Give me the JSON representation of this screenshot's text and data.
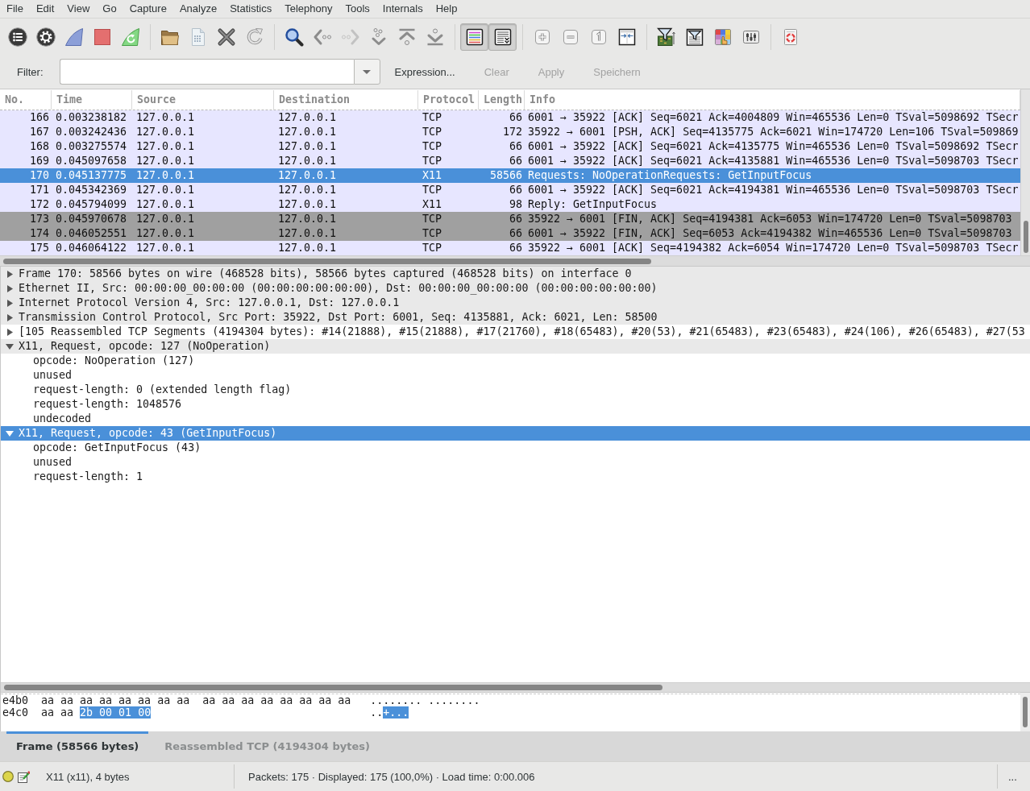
{
  "menu": [
    "File",
    "Edit",
    "View",
    "Go",
    "Capture",
    "Analyze",
    "Statistics",
    "Telephony",
    "Tools",
    "Internals",
    "Help"
  ],
  "toolbar": [
    [
      {
        "kind": "interfaces",
        "pressed": false,
        "disabled": false
      },
      {
        "kind": "options",
        "pressed": false,
        "disabled": false
      },
      {
        "kind": "start",
        "pressed": false,
        "disabled": false
      },
      {
        "kind": "stop",
        "pressed": false,
        "disabled": false
      },
      {
        "kind": "restart",
        "pressed": false,
        "disabled": false
      }
    ],
    [
      {
        "kind": "open",
        "pressed": false,
        "disabled": false
      },
      {
        "kind": "save",
        "pressed": false,
        "disabled": false
      },
      {
        "kind": "close",
        "pressed": false,
        "disabled": false
      },
      {
        "kind": "reload",
        "pressed": false,
        "disabled": false
      }
    ],
    [
      {
        "kind": "find",
        "pressed": false,
        "disabled": false
      },
      {
        "kind": "back",
        "pressed": false,
        "disabled": false
      },
      {
        "kind": "forward",
        "pressed": false,
        "disabled": true
      },
      {
        "kind": "goto",
        "pressed": false,
        "disabled": false
      },
      {
        "kind": "first",
        "pressed": false,
        "disabled": false
      },
      {
        "kind": "last",
        "pressed": false,
        "disabled": false
      }
    ],
    [
      {
        "kind": "colorize",
        "pressed": true,
        "disabled": false
      },
      {
        "kind": "autoscroll",
        "pressed": true,
        "disabled": false
      }
    ],
    [
      {
        "kind": "zoomin",
        "pressed": false,
        "disabled": false
      },
      {
        "kind": "zoomout",
        "pressed": false,
        "disabled": false
      },
      {
        "kind": "normalsize",
        "pressed": false,
        "disabled": false
      },
      {
        "kind": "resize",
        "pressed": false,
        "disabled": false
      }
    ],
    [
      {
        "kind": "capfilter",
        "pressed": false,
        "disabled": false
      },
      {
        "kind": "dispfilter",
        "pressed": false,
        "disabled": false
      },
      {
        "kind": "coloring",
        "pressed": false,
        "disabled": false
      },
      {
        "kind": "prefs",
        "pressed": false,
        "disabled": false
      }
    ],
    [
      {
        "kind": "help",
        "pressed": false,
        "disabled": false
      }
    ]
  ],
  "filter": {
    "label": "Filter:",
    "buttons": [
      {
        "label": "Expression...",
        "disabled": false
      },
      {
        "label": "Clear",
        "disabled": true
      },
      {
        "label": "Apply",
        "disabled": true
      },
      {
        "label": "Speichern",
        "disabled": true
      }
    ]
  },
  "packet_list": {
    "columns": [
      "No.",
      "Time",
      "Source",
      "Destination",
      "Protocol",
      "Length",
      "Info"
    ],
    "rows": [
      {
        "no": "166",
        "time": "0.003238182",
        "source": "127.0.0.1",
        "destination": "127.0.0.1",
        "protocol": "TCP",
        "length": "66",
        "info": "6001 → 35922 [ACK] Seq=6021 Ack=4004809 Win=465536 Len=0 TSval=5098692 TSecr",
        "selected": false,
        "color": "#e7e6ff"
      },
      {
        "no": "167",
        "time": "0.003242436",
        "source": "127.0.0.1",
        "destination": "127.0.0.1",
        "protocol": "TCP",
        "length": "172",
        "info": "35922 → 6001 [PSH, ACK] Seq=4135775 Ack=6021 Win=174720 Len=106 TSval=509869",
        "selected": false,
        "color": "#e7e6ff"
      },
      {
        "no": "168",
        "time": "0.003275574",
        "source": "127.0.0.1",
        "destination": "127.0.0.1",
        "protocol": "TCP",
        "length": "66",
        "info": "6001 → 35922 [ACK] Seq=6021 Ack=4135775 Win=465536 Len=0 TSval=5098692 TSecr",
        "selected": false,
        "color": "#e7e6ff"
      },
      {
        "no": "169",
        "time": "0.045097658",
        "source": "127.0.0.1",
        "destination": "127.0.0.1",
        "protocol": "TCP",
        "length": "66",
        "info": "6001 → 35922 [ACK] Seq=6021 Ack=4135881 Win=465536 Len=0 TSval=5098703 TSecr",
        "selected": false,
        "color": "#e7e6ff"
      },
      {
        "no": "170",
        "time": "0.045137775",
        "source": "127.0.0.1",
        "destination": "127.0.0.1",
        "protocol": "X11",
        "length": "58566",
        "info": "Requests: NoOperationRequests: GetInputFocus",
        "selected": true
      },
      {
        "no": "171",
        "time": "0.045342369",
        "source": "127.0.0.1",
        "destination": "127.0.0.1",
        "protocol": "TCP",
        "length": "66",
        "info": "6001 → 35922 [ACK] Seq=6021 Ack=4194381 Win=465536 Len=0 TSval=5098703 TSecr",
        "selected": false,
        "color": "#e7e6ff"
      },
      {
        "no": "172",
        "time": "0.045794099",
        "source": "127.0.0.1",
        "destination": "127.0.0.1",
        "protocol": "X11",
        "length": "98",
        "info": "Reply: GetInputFocus",
        "selected": false,
        "color": "#e7e6ff"
      },
      {
        "no": "173",
        "time": "0.045970678",
        "source": "127.0.0.1",
        "destination": "127.0.0.1",
        "protocol": "TCP",
        "length": "66",
        "info": "35922 → 6001 [FIN, ACK] Seq=4194381 Ack=6053 Win=174720 Len=0 TSval=5098703",
        "selected": false,
        "color": "#a0a0a0"
      },
      {
        "no": "174",
        "time": "0.046052551",
        "source": "127.0.0.1",
        "destination": "127.0.0.1",
        "protocol": "TCP",
        "length": "66",
        "info": "6001 → 35922 [FIN, ACK] Seq=6053 Ack=4194382 Win=465536 Len=0 TSval=5098703",
        "selected": false,
        "color": "#a0a0a0"
      },
      {
        "no": "175",
        "time": "0.046064122",
        "source": "127.0.0.1",
        "destination": "127.0.0.1",
        "protocol": "TCP",
        "length": "66",
        "info": "35922 → 6001 [ACK] Seq=4194382 Ack=6054 Win=174720 Len=0 TSval=5098703 TSecr",
        "selected": false,
        "color": "#e7e6ff"
      }
    ]
  },
  "details": [
    {
      "text": "Frame 170: 58566 bytes on wire (468528 bits), 58566 bytes captured (468528 bits) on interface 0",
      "expanded": false,
      "selected": false,
      "shaded": true
    },
    {
      "text": "Ethernet II, Src: 00:00:00_00:00:00 (00:00:00:00:00:00), Dst: 00:00:00_00:00:00 (00:00:00:00:00:00)",
      "expanded": false,
      "selected": false,
      "shaded": true
    },
    {
      "text": "Internet Protocol Version 4, Src: 127.0.0.1, Dst: 127.0.0.1",
      "expanded": false,
      "selected": false,
      "shaded": true
    },
    {
      "text": "Transmission Control Protocol, Src Port: 35922, Dst Port: 6001, Seq: 4135881, Ack: 6021, Len: 58500",
      "expanded": false,
      "selected": false,
      "shaded": true
    },
    {
      "text": "[105 Reassembled TCP Segments (4194304 bytes): #14(21888), #15(21888), #17(21760), #18(65483), #20(53), #21(65483), #23(65483), #24(106), #26(65483), #27(53",
      "expanded": false,
      "selected": false,
      "shaded": false
    },
    {
      "text": "X11, Request, opcode: 127 (NoOperation)",
      "expanded": true,
      "selected": false,
      "shaded": true,
      "children": [
        {
          "text": "opcode: NoOperation (127)",
          "selected": false,
          "shaded": false
        },
        {
          "text": "unused",
          "selected": false,
          "shaded": false
        },
        {
          "text": "request-length: 0 (extended length flag)",
          "selected": false,
          "shaded": false
        },
        {
          "text": "request-length: 1048576",
          "selected": false,
          "shaded": false
        },
        {
          "text": "undecoded",
          "selected": false,
          "shaded": false
        }
      ]
    },
    {
      "text": "X11, Request, opcode: 43 (GetInputFocus)",
      "expanded": true,
      "selected": true,
      "shaded": false,
      "children": [
        {
          "text": "opcode: GetInputFocus (43)",
          "selected": false,
          "shaded": false
        },
        {
          "text": "unused",
          "selected": false,
          "shaded": false
        },
        {
          "text": "request-length: 1",
          "selected": false,
          "shaded": false
        }
      ]
    }
  ],
  "bytes": {
    "lines": [
      {
        "offset": "e4b0",
        "hex": [
          {
            "text": "aa aa aa aa aa aa aa aa  aa aa aa aa aa aa aa aa",
            "selected": false
          }
        ],
        "ascii": [
          {
            "text": "........ ........",
            "selected": false
          }
        ]
      },
      {
        "offset": "e4c0",
        "hex": [
          {
            "text": "aa aa",
            "selected": false
          },
          {
            "text": "2b 00 01 00",
            "selected": true
          }
        ],
        "ascii": [
          {
            "text": "..",
            "selected": false
          },
          {
            "text": "+...",
            "selected": true
          }
        ]
      }
    ],
    "tabs": [
      {
        "label": "Frame (58566 bytes)",
        "selected": true
      },
      {
        "label": "Reassembled TCP (4194304 bytes)",
        "selected": false
      }
    ]
  },
  "status_bar": {
    "field": "X11 (x11), 4 bytes",
    "summary": "Packets: 175 · Displayed: 175 (100,0%) · Load time: 0:00.006",
    "profile": "..."
  }
}
